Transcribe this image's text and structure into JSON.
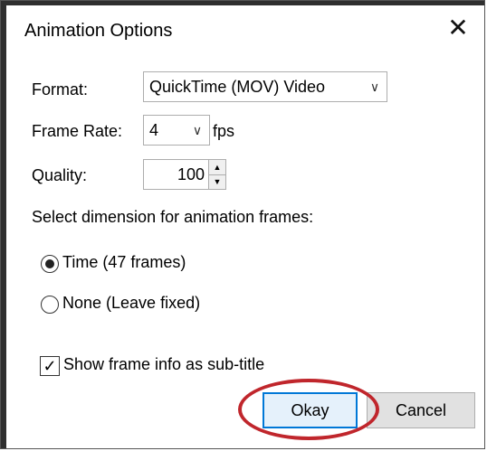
{
  "window": {
    "title": "Animation Options",
    "close_glyph": "✕"
  },
  "format": {
    "label": "Format:",
    "selected": "QuickTime (MOV) Video"
  },
  "frame_rate": {
    "label": "Frame Rate:",
    "selected": "4",
    "unit": "fps"
  },
  "quality": {
    "label": "Quality:",
    "value": "100"
  },
  "dimension": {
    "label": "Select dimension for animation frames:",
    "options": [
      {
        "label": "Time (47 frames)",
        "selected": true
      },
      {
        "label": "None (Leave fixed)",
        "selected": false
      }
    ]
  },
  "subtitle_option": {
    "label": "Show frame info as sub-title",
    "checked": true
  },
  "buttons": {
    "ok": "Okay",
    "cancel": "Cancel"
  },
  "annotation": {
    "highlight_color": "#c0262c",
    "target": "Okay"
  }
}
